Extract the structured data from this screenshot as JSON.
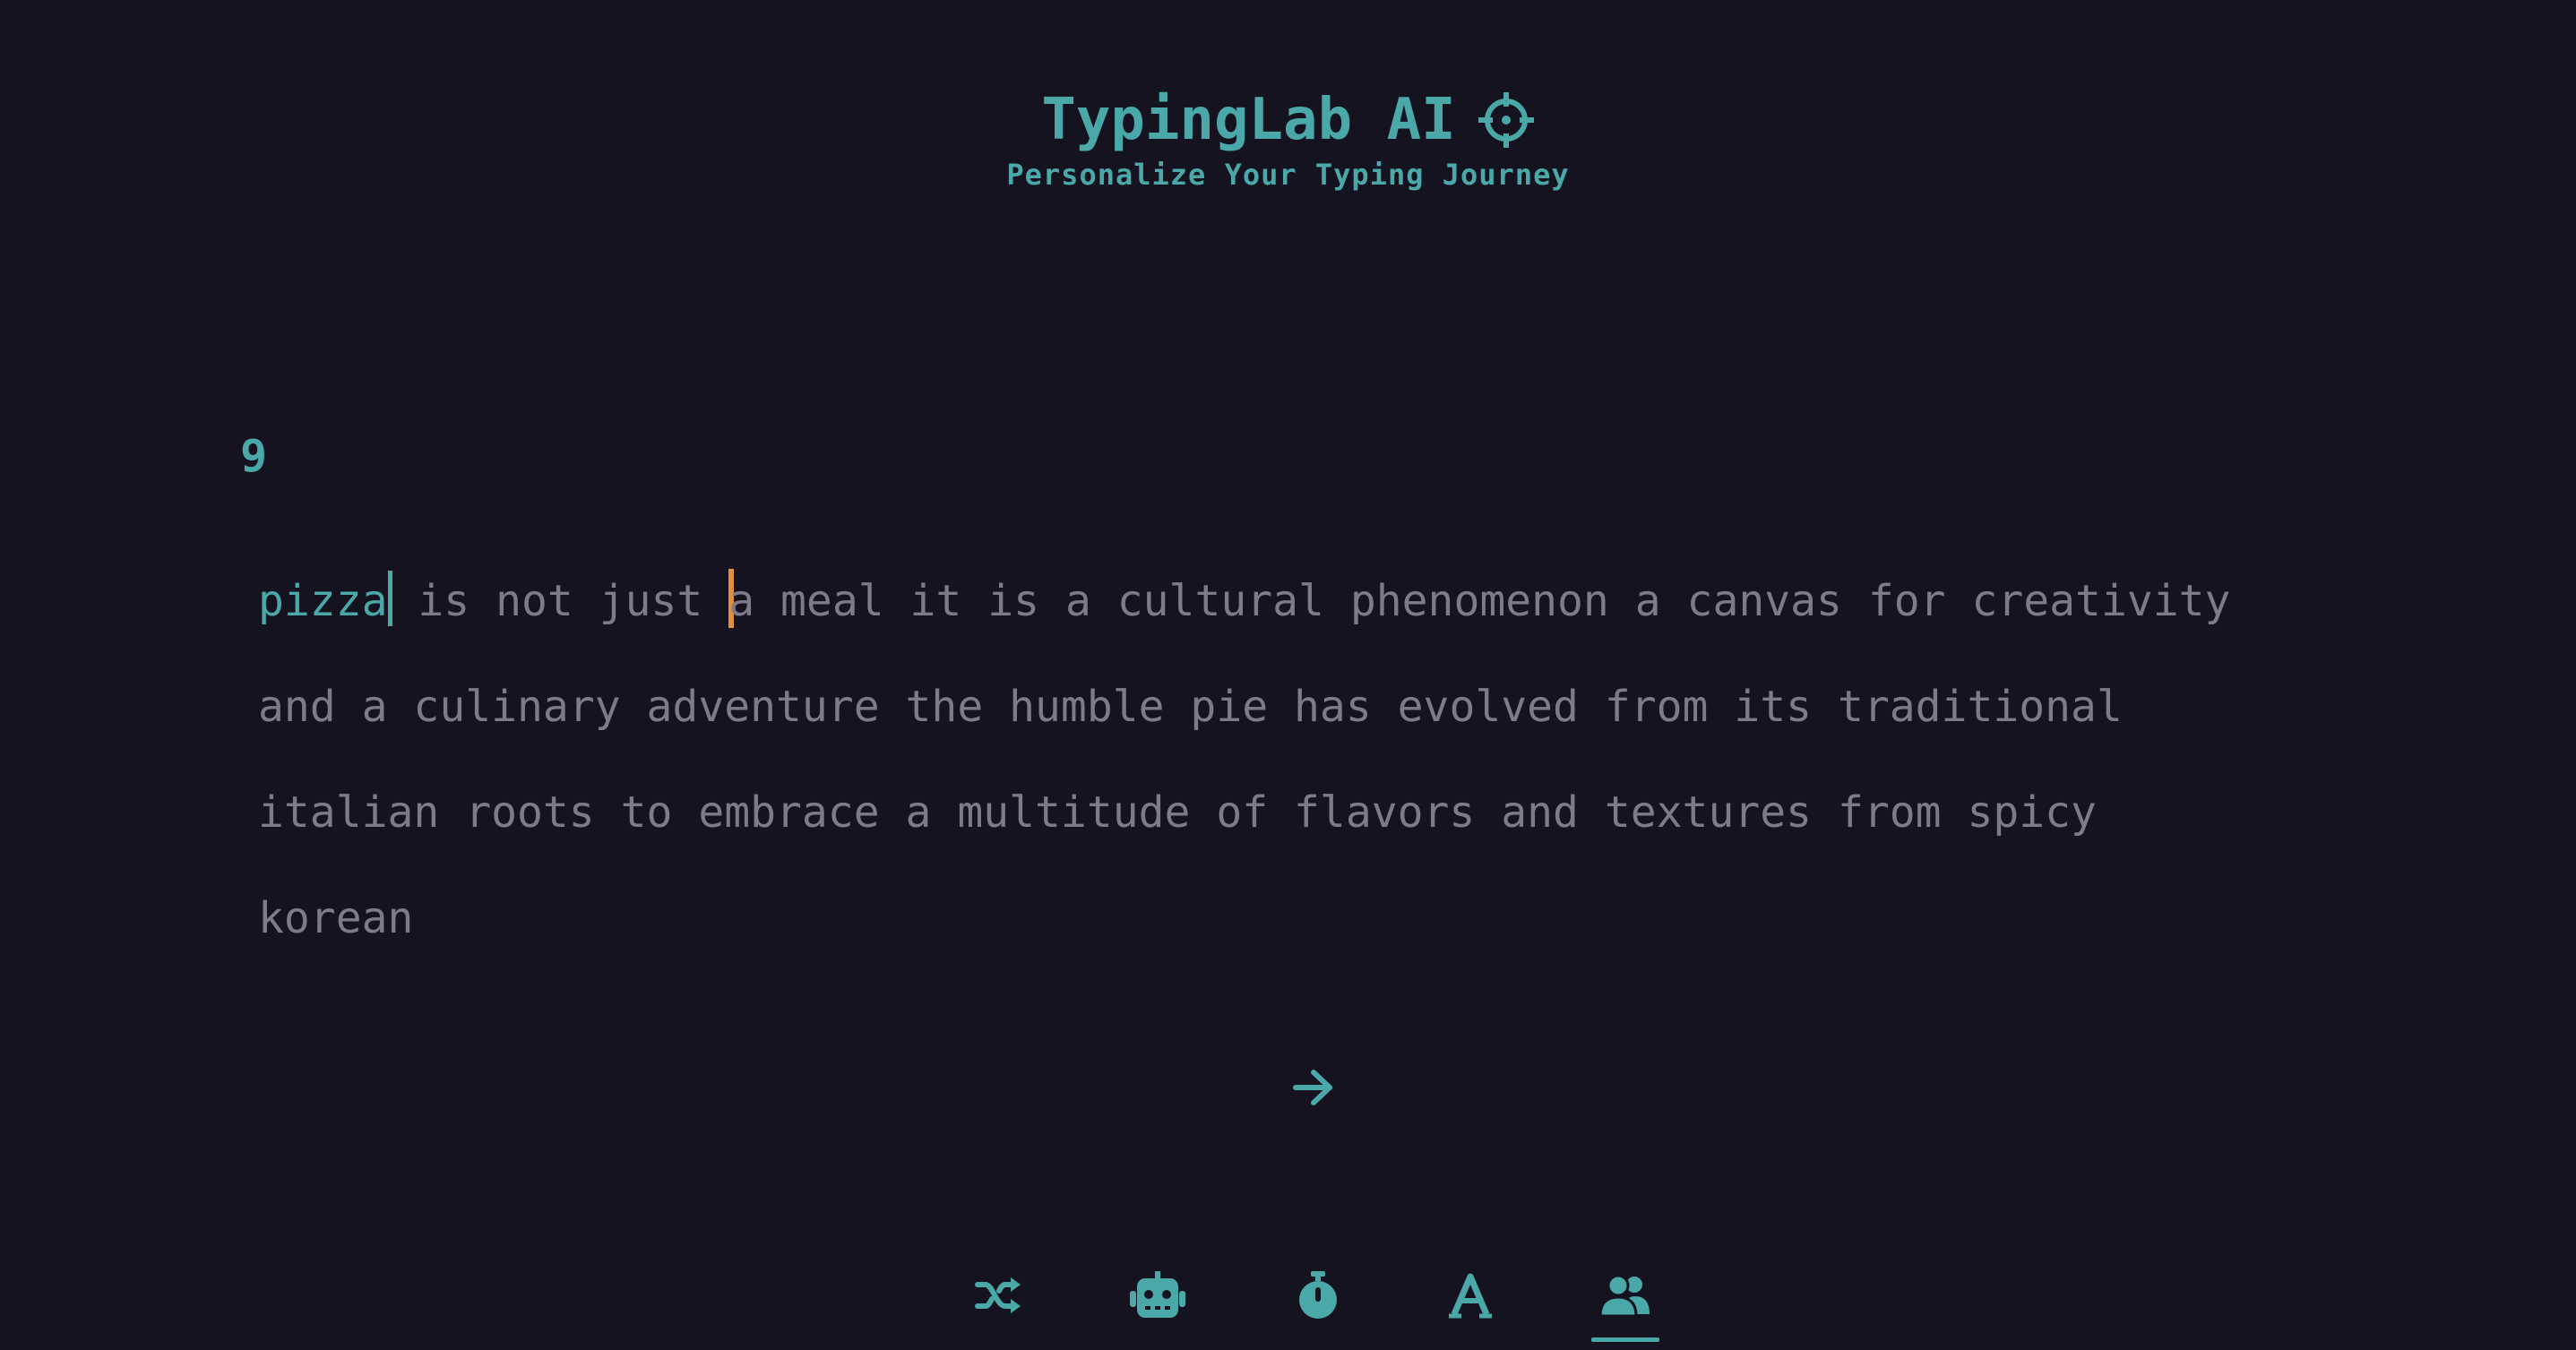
{
  "header": {
    "title": "TypingLab AI",
    "subtitle": "Personalize Your Typing Journey",
    "title_icon": "crosshair-icon"
  },
  "test": {
    "word_count": "9",
    "typed_word": "pizza",
    "lines": [
      [
        "is",
        "not",
        "just",
        "a",
        "meal",
        "it",
        "is",
        "a",
        "cultural",
        "phenomenon",
        "a",
        "canvas",
        "for",
        "creativity"
      ],
      [
        "and",
        "a",
        "culinary",
        "adventure",
        "the",
        "humble",
        "pie",
        "has",
        "evolved",
        "from",
        "its",
        "traditional"
      ],
      [
        "italian",
        "roots",
        "to",
        "embrace",
        "a",
        "multitude",
        "of",
        "flavors",
        "and",
        "textures",
        "from",
        "spicy"
      ],
      [
        "korean"
      ]
    ]
  },
  "controls": {
    "next_icon": "arrow-right-icon",
    "modes": [
      {
        "icon": "shuffle-icon",
        "active": false
      },
      {
        "icon": "robot-icon",
        "active": false
      },
      {
        "icon": "stopwatch-icon",
        "active": false
      },
      {
        "icon": "font-icon",
        "active": false
      },
      {
        "icon": "users-icon",
        "active": true
      }
    ]
  },
  "colors": {
    "background": "#14131f",
    "accent": "#4aa8a8",
    "untyped_text": "#7e7a8c",
    "ghost_caret": "#e0913e"
  }
}
